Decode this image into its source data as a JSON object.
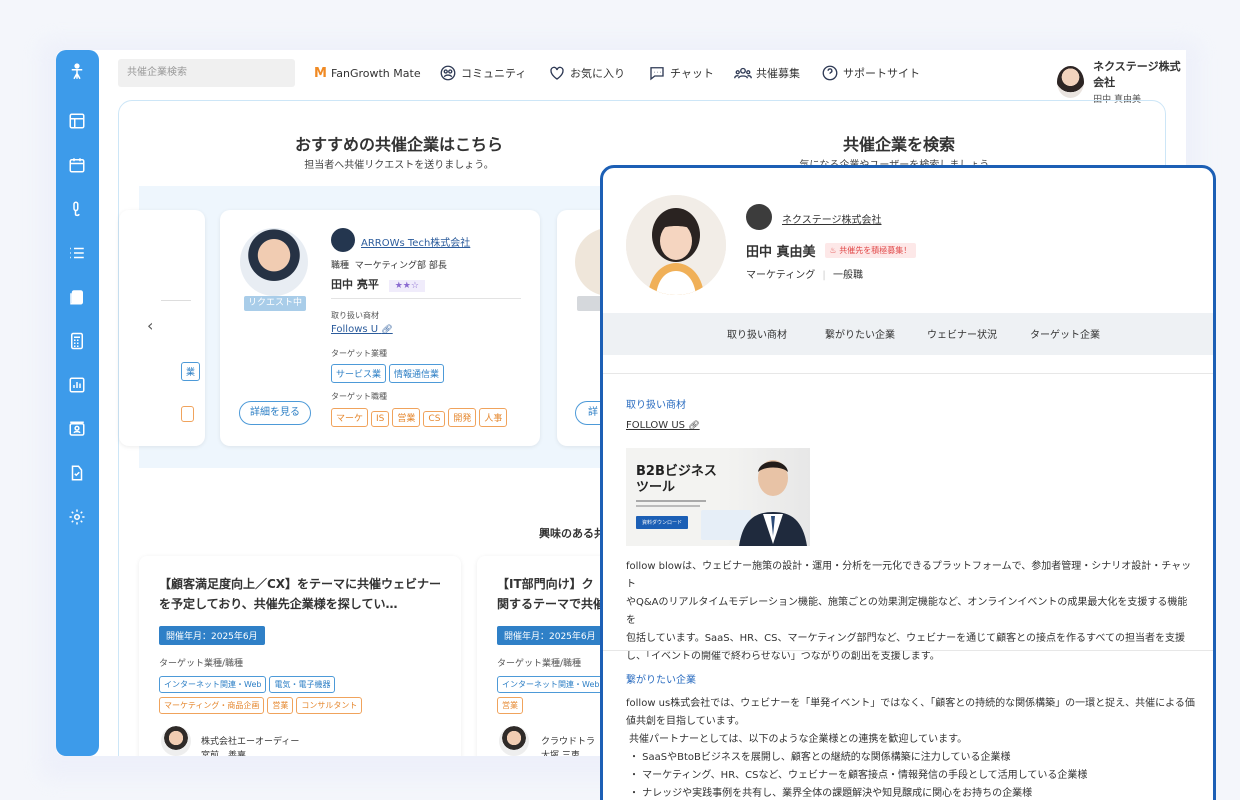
{
  "search": {
    "placeholder": "共催企業検索"
  },
  "nav": {
    "brand": "FanGrowth Mate",
    "community": "コミュニティ",
    "favorites": "お気に入り",
    "chat": "チャット",
    "recruit": "共催募集",
    "support": "サポートサイト"
  },
  "user": {
    "company": "ネクステージ株式会社",
    "name": "田中 真由美"
  },
  "recommend": {
    "title": "おすすめの共催企業はこちら",
    "subtitle": "担当者へ共催リクエストを送りましょう。"
  },
  "search_section": {
    "title": "共催企業を検索",
    "subtitle": "気になる企業やユーザーを検索しましょう。"
  },
  "card_main": {
    "company": "ARROWs Tech株式会社",
    "position_label": "職種",
    "position": "マーケティング部 部長",
    "name": "田中 亮平",
    "stars": "★★☆",
    "status": "リクエスト中",
    "products_label": "取り扱い商材",
    "product": "Follows U",
    "industry_label": "ターゲット業種",
    "industries": [
      "サービス業",
      "情報通信業"
    ],
    "jobs_label": "ターゲット職種",
    "jobs": [
      "マーケ",
      "IS",
      "営業",
      "CS",
      "開発",
      "人事"
    ],
    "detail_button": "詳細を見る"
  },
  "card_left_partial": {
    "tag": "業"
  },
  "card_right_partial": {
    "button_fragment": "詳"
  },
  "interest_heading": "興味のある共",
  "lower_cards": [
    {
      "title": "【顧客満足度向上／CX】をテーマに共催ウェビナーを予定しており、共催先企業様を探してい…",
      "date": "開催年月：2025年6月",
      "target_label": "ターゲット業種/職種",
      "tags_blue": [
        "インターネット関連・Web",
        "電気・電子機器"
      ],
      "tags_orange": [
        "マーケティング・商品企画",
        "営業",
        "コンサルタント"
      ],
      "company": "株式会社エーオーディー",
      "person": "宮前　善嘉"
    },
    {
      "title": "【IT部門向け】ク…関するテーマで共催…",
      "title_line1": "【IT部門向け】ク",
      "title_line2": "関するテーマで共催",
      "date": "開催年月：2025年6月",
      "target_label": "ターゲット業種/職種",
      "tags_blue": [
        "インターネット関連・Web"
      ],
      "tags_orange": [
        "営業"
      ],
      "company": "クラウドトラ",
      "person": "大塚 三恵"
    }
  ],
  "profile": {
    "company": "ネクステージ株式会社",
    "name": "田中 真由美",
    "recruit_badge": "共催先を積極募集！",
    "department": "マーケティング",
    "role": "一般職",
    "tabs": [
      "取り扱い商材",
      "繋がりたい企業",
      "ウェビナー状況",
      "ターゲット企業"
    ],
    "products_label": "取り扱い商材",
    "product_link": "FOLLOW US",
    "banner_title": "B2Bビジネス\nツール",
    "banner_title_line1": "B2Bビジネス",
    "banner_title_line2": "ツール",
    "banner_button": "資料ダウンロード",
    "description": [
      "follow blowは、ウェビナー施策の設計・運用・分析を一元化できるプラットフォームで、参加者管理・シナリオ設計・チャット",
      "やQ&Aのリアルタイムモデレーション機能、施策ごとの効果測定機能など、オンラインイベントの成果最大化を支援する機能を",
      "包括しています。SaaS、HR、CS、マーケティング部門など、ウェビナーを通じて顧客との接点を作るすべての担当者を支援",
      "し、「イベントの開催で終わらせない」つながりの創出を支援します。"
    ],
    "connect_label": "繋がりたい企業",
    "connect_text": [
      "follow us株式会社では、ウェビナーを「単発イベント」ではなく、「顧客との持続的な関係構築」の一環と捉え、共催による価",
      "値共創を目指しています。",
      "共催パートナーとしては、以下のような企業様との連携を歓迎しています。",
      "・ SaaSやBtoBビジネスを展開し、顧客との継続的な関係構築に注力している企業様",
      "・ マーケティング、HR、CSなど、ウェビナーを顧客接点・情報発信の手段として活用している企業様",
      "・ ナレッジや実践事例を共有し、業界全体の課題解決や知見醸成に関心をお持ちの企業様"
    ]
  },
  "colors": {
    "sidebar": "#3d9bea",
    "accent": "#1c5fb5",
    "link": "#2a6cc0",
    "orange": "#e5872e"
  }
}
